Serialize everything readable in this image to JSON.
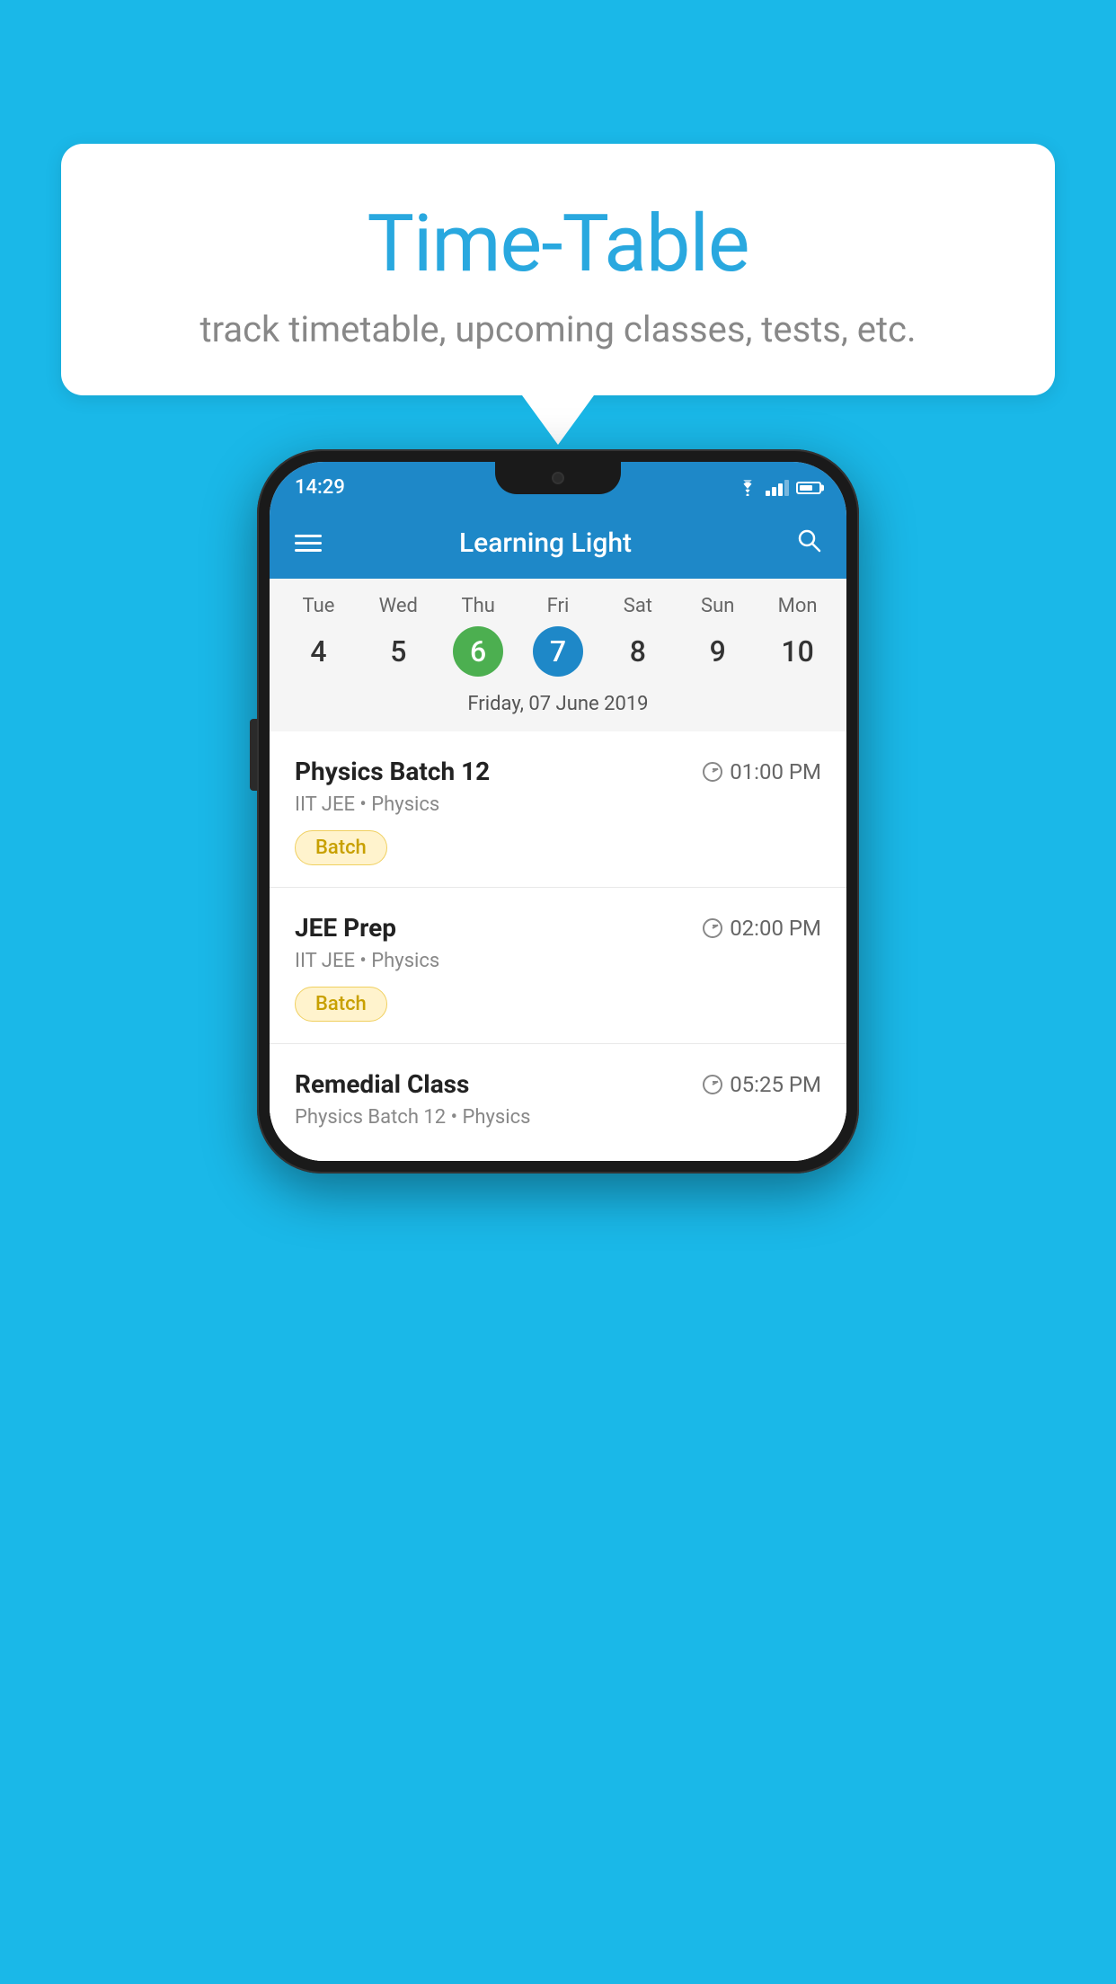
{
  "background_color": "#1ab8e8",
  "speech_bubble": {
    "title": "Time-Table",
    "subtitle": "track timetable, upcoming classes, tests, etc."
  },
  "phone": {
    "status_bar": {
      "time": "14:29"
    },
    "app_bar": {
      "title": "Learning Light"
    },
    "calendar": {
      "days": [
        {
          "name": "Tue",
          "number": "4",
          "state": "normal"
        },
        {
          "name": "Wed",
          "number": "5",
          "state": "normal"
        },
        {
          "name": "Thu",
          "number": "6",
          "state": "today"
        },
        {
          "name": "Fri",
          "number": "7",
          "state": "selected"
        },
        {
          "name": "Sat",
          "number": "8",
          "state": "normal"
        },
        {
          "name": "Sun",
          "number": "9",
          "state": "normal"
        },
        {
          "name": "Mon",
          "number": "10",
          "state": "normal"
        }
      ],
      "selected_date_label": "Friday, 07 June 2019"
    },
    "schedule": [
      {
        "title": "Physics Batch 12",
        "time": "01:00 PM",
        "subtitle": "IIT JEE • Physics",
        "badge": "Batch"
      },
      {
        "title": "JEE Prep",
        "time": "02:00 PM",
        "subtitle": "IIT JEE • Physics",
        "badge": "Batch"
      },
      {
        "title": "Remedial Class",
        "time": "05:25 PM",
        "subtitle": "Physics Batch 12 • Physics",
        "badge": null
      }
    ]
  }
}
